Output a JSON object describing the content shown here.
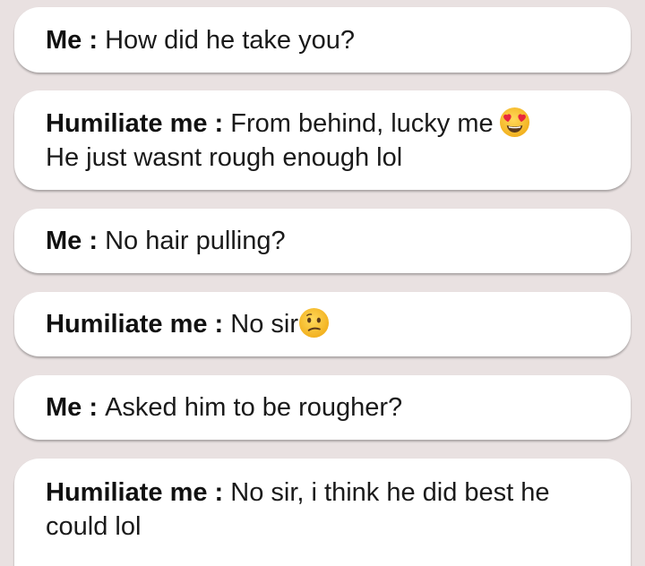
{
  "messages": [
    {
      "speaker": "Me",
      "separator": " : ",
      "text": "How did he take you?",
      "emoji": ""
    },
    {
      "speaker": "Humiliate me",
      "separator": " : ",
      "text": "From behind, lucky me",
      "emoji": "heart-eyes-emoji",
      "text2": "He just wasnt rough enough lol"
    },
    {
      "speaker": "Me",
      "separator": " : ",
      "text": "No hair pulling?",
      "emoji": ""
    },
    {
      "speaker": "Humiliate me",
      "separator": " : ",
      "text": "No sir",
      "emoji": "confused-face-emoji"
    },
    {
      "speaker": "Me",
      "separator": " : ",
      "text": "Asked him to be rougher?",
      "emoji": ""
    },
    {
      "speaker": "Humiliate me",
      "separator": " : ",
      "text": "No sir, i think he did best he could lol",
      "emoji": ""
    }
  ],
  "colors": {
    "background": "#e9e1e1",
    "bubble": "#ffffff",
    "text": "#1a1a1a",
    "emoji_face": "#f7c23b"
  }
}
